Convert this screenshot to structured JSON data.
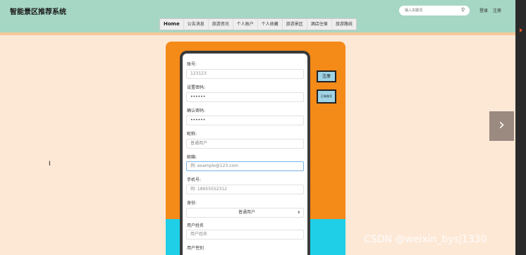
{
  "header": {
    "site_title": "智能景区推荐系统",
    "search_placeholder": "输入关键词",
    "login_label": "登录",
    "register_label": "注册"
  },
  "nav": {
    "items": [
      "Home",
      "公告消息",
      "旅游资讯",
      "个人账户",
      "个人收藏",
      "旅游景区",
      "酒店住宿",
      "旅游路线"
    ]
  },
  "form": {
    "account_label": "账号:",
    "account_value": "123123",
    "password_label": "设置密码:",
    "password_value": "••••••",
    "confirm_label": "确认密码:",
    "confirm_value": "••••••",
    "nickname_label": "昵称:",
    "nickname_value": "普通用户",
    "email_label": "邮箱:",
    "email_placeholder": "例: example@123.com",
    "phone_label": "手机号:",
    "phone_placeholder": "例: 18955552312",
    "identity_label": "身份:",
    "identity_value": "普通用户",
    "username_label": "用户姓名",
    "username_placeholder": "用户姓名",
    "gender_label": "用户性别"
  },
  "actions": {
    "register_button": "注册",
    "has_account_button": "已有账号"
  },
  "next_arrow": "›",
  "watermark": "CSDN @weixin_bysj1330",
  "colors": {
    "header_bg": "#a6d6c4",
    "page_bg": "#fde8d6",
    "panel_orange": "#f48a18",
    "panel_cyan": "#1fcfe8"
  }
}
